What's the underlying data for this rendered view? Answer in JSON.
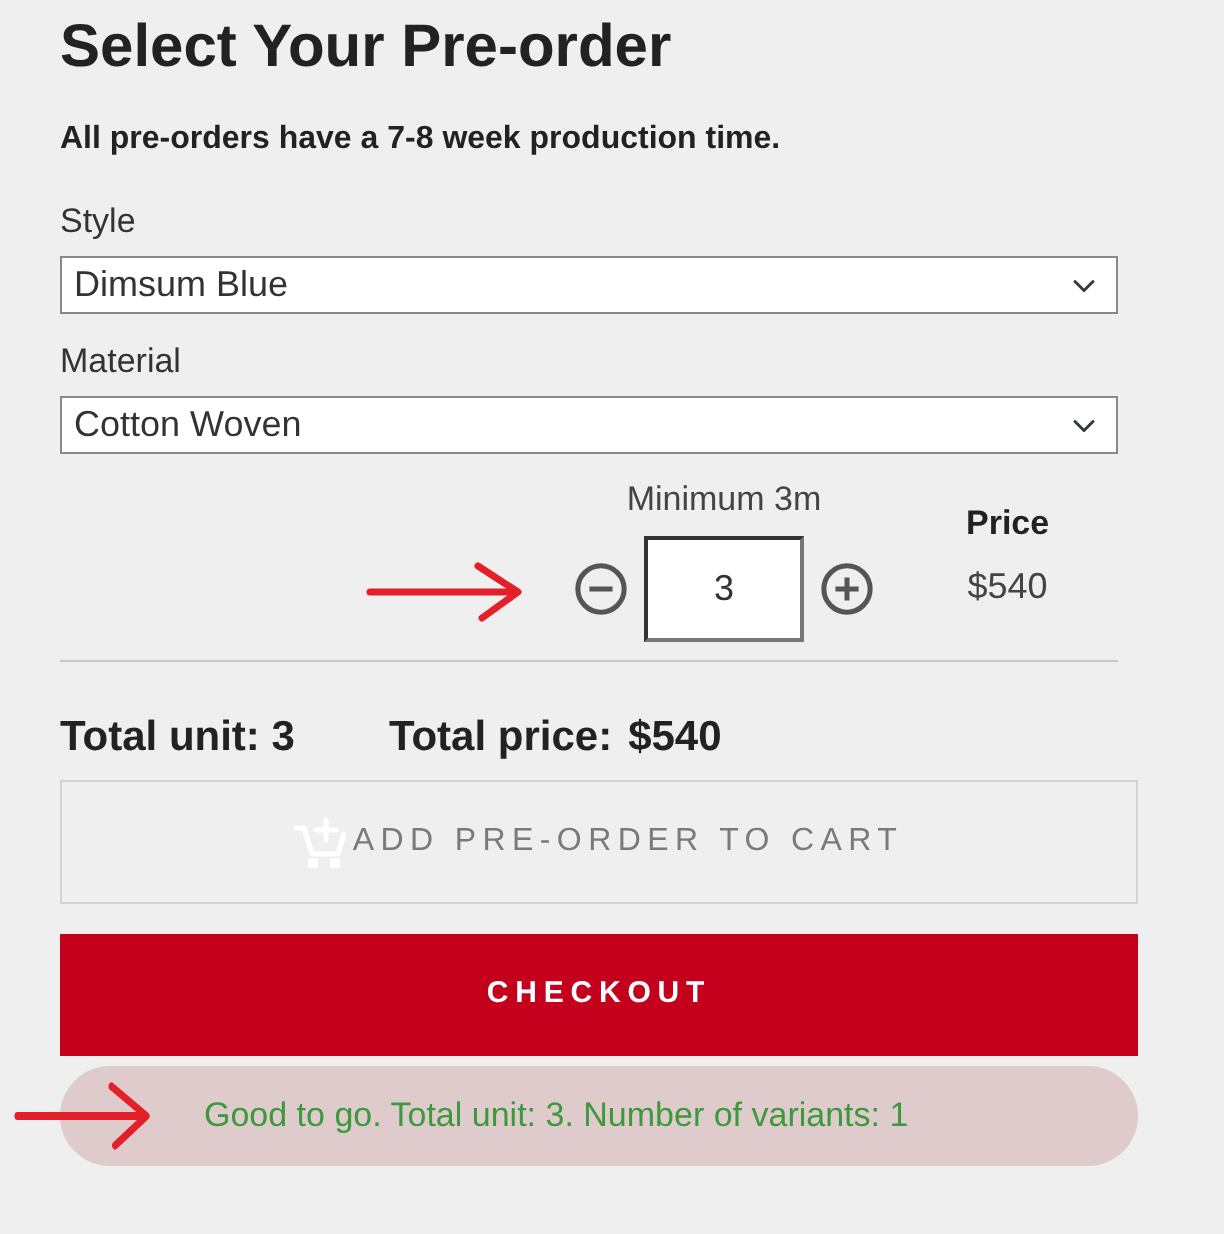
{
  "heading": "Select Your Pre-order",
  "notice": "All pre-orders have a 7-8 week production time.",
  "options": [
    {
      "label": "Style",
      "value": "Dimsum Blue"
    },
    {
      "label": "Material",
      "value": "Cotton Woven"
    }
  ],
  "quantity": {
    "caption": "Minimum 3m",
    "value": "3",
    "arrow_marked": true
  },
  "price": {
    "label": "Price",
    "value": "$540"
  },
  "totals": {
    "unit": "Total unit: 3",
    "price_label": "Total price:",
    "price": "$540"
  },
  "add_to_cart": {
    "label": "ADD PRE-ORDER TO CART",
    "disabled": true
  },
  "checkout": {
    "label": "CHECKOUT"
  },
  "status": {
    "message": "Good to go. Total unit: 3. Number of variants: 1",
    "arrow_marked": true
  }
}
